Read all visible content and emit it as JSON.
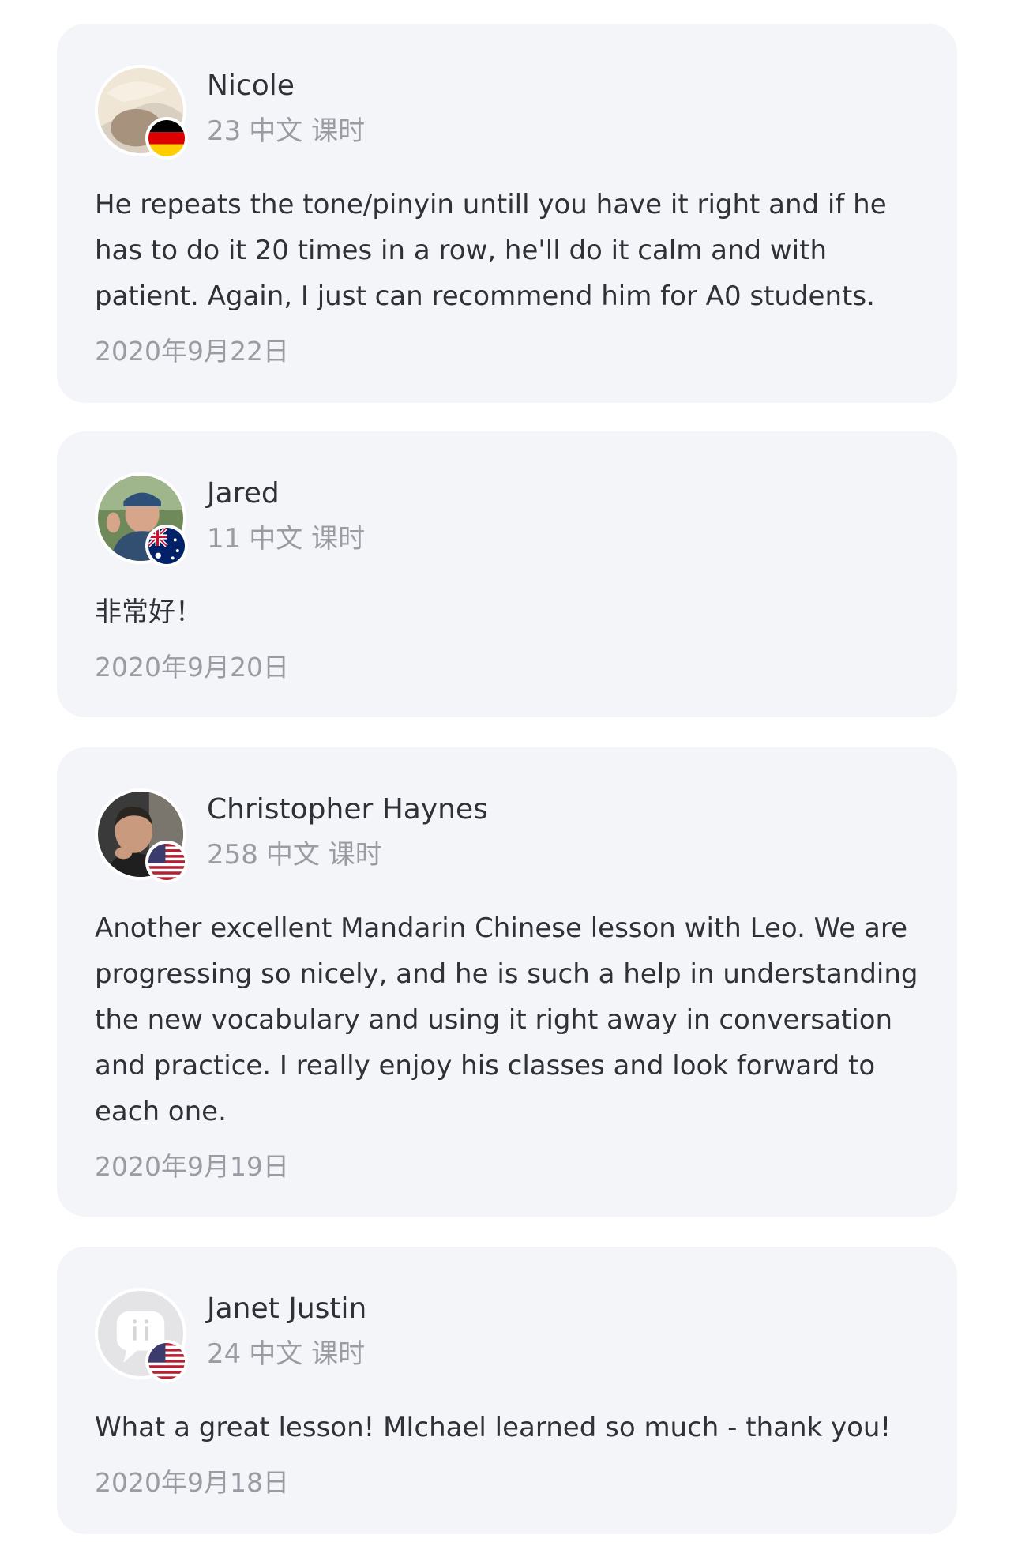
{
  "reviews": [
    {
      "name": "Nicole",
      "lesson_count": "23",
      "lesson_label": "中文 课时",
      "text": "He repeats the tone/pinyin untill you have it right and if he has to do it 20 times in a row, he'll do it calm and with patient. Again, I just can recommend him for A0 students.",
      "date": "2020年9月22日",
      "flag": "germany-flag-icon"
    },
    {
      "name": "Jared",
      "lesson_count": "11",
      "lesson_label": "中文 课时",
      "text": "非常好！",
      "date": "2020年9月20日",
      "flag": "australia-flag-icon"
    },
    {
      "name": "Christopher Haynes",
      "lesson_count": "258",
      "lesson_label": "中文 课时",
      "text": "Another excellent Mandarin Chinese lesson with Leo. We are progressing so nicely, and he is such a help in understanding the new vocabulary and using it right away in conversation and practice. I really enjoy his classes and look forward to each one.",
      "date": "2020年9月19日",
      "flag": "usa-flag-icon"
    },
    {
      "name": "Janet Justin",
      "lesson_count": "24",
      "lesson_label": "中文 课时",
      "text": "What a great lesson! MIchael learned so much - thank you!",
      "date": "2020年9月18日",
      "flag": "usa-flag-icon"
    }
  ],
  "colors": {
    "card_bg": "#f4f5f8",
    "text": "#2f3138",
    "muted": "#9a9ca4"
  }
}
